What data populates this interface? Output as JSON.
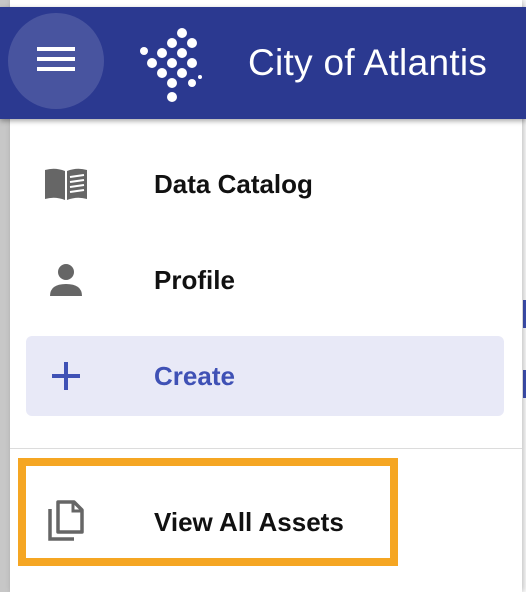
{
  "app": {
    "title": "City of Atlantis",
    "brand_color": "#2b3990",
    "accent_color": "#3f51b5",
    "highlight_color": "#f5a623"
  },
  "menu": {
    "icon": "hamburger-menu-icon"
  },
  "logo": {
    "icon": "dotted-diamond-logo"
  },
  "nav": {
    "items": [
      {
        "label": "Data Catalog",
        "icon": "book-open-icon"
      },
      {
        "label": "Profile",
        "icon": "person-icon"
      },
      {
        "label": "Create",
        "icon": "plus-icon",
        "selected": true
      }
    ],
    "secondary": [
      {
        "label": "View All Assets",
        "icon": "copy-documents-icon",
        "highlighted": true
      }
    ]
  }
}
